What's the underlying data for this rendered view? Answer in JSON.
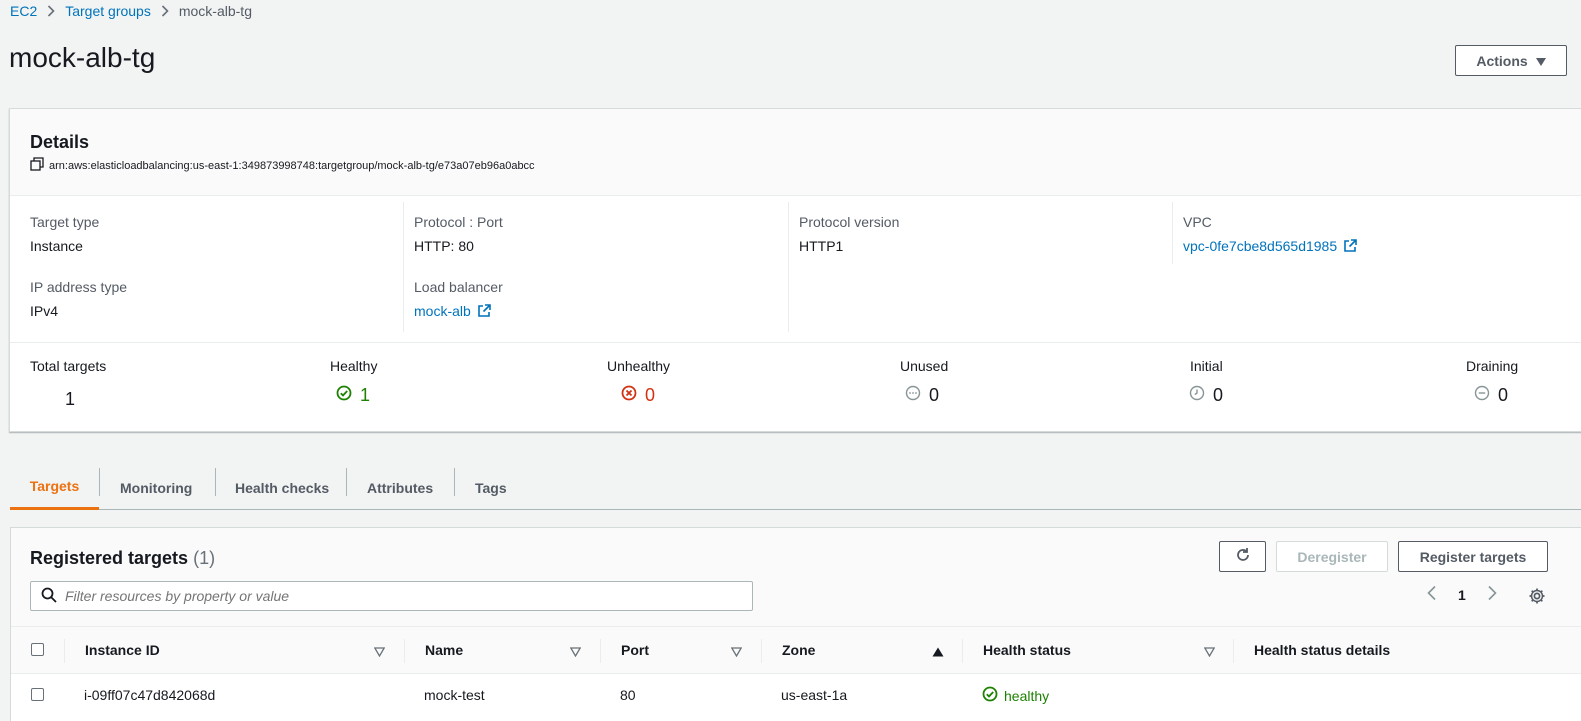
{
  "breadcrumb": {
    "items": [
      "EC2",
      "Target groups"
    ],
    "current": "mock-alb-tg"
  },
  "page": {
    "title": "mock-alb-tg",
    "actions_label": "Actions"
  },
  "details": {
    "title": "Details",
    "arn": "arn:aws:elasticloadbalancing:us-east-1:349873998748:targetgroup/mock-alb-tg/e73a07eb96a0abcc",
    "fields": {
      "target_type": {
        "label": "Target type",
        "value": "Instance"
      },
      "ip_address_type": {
        "label": "IP address type",
        "value": "IPv4"
      },
      "protocol_port": {
        "label": "Protocol : Port",
        "value": "HTTP: 80"
      },
      "load_balancer": {
        "label": "Load balancer",
        "value": "mock-alb"
      },
      "protocol_version": {
        "label": "Protocol version",
        "value": "HTTP1"
      },
      "vpc": {
        "label": "VPC",
        "value": "vpc-0fe7cbe8d565d1985"
      }
    },
    "counts": {
      "total": {
        "label": "Total targets",
        "value": "1"
      },
      "healthy": {
        "label": "Healthy",
        "value": "1"
      },
      "unhealthy": {
        "label": "Unhealthy",
        "value": "0"
      },
      "unused": {
        "label": "Unused",
        "value": "0"
      },
      "initial": {
        "label": "Initial",
        "value": "0"
      },
      "draining": {
        "label": "Draining",
        "value": "0"
      }
    }
  },
  "tabs": [
    "Targets",
    "Monitoring",
    "Health checks",
    "Attributes",
    "Tags"
  ],
  "registered": {
    "title": "Registered targets",
    "count": "(1)",
    "deregister_label": "Deregister",
    "register_label": "Register targets",
    "search_placeholder": "Filter resources by property or value",
    "page": "1",
    "columns": [
      "Instance ID",
      "Name",
      "Port",
      "Zone",
      "Health status",
      "Health status details"
    ],
    "rows": [
      {
        "instance_id": "i-09ff07c47d842068d",
        "name": "mock-test",
        "port": "80",
        "zone": "us-east-1a",
        "health": "healthy",
        "details": ""
      }
    ]
  },
  "colors": {
    "link": "#0073bb",
    "accent": "#ec7211",
    "healthy": "#1d8102",
    "unhealthy": "#d13212",
    "muted": "#687078"
  }
}
